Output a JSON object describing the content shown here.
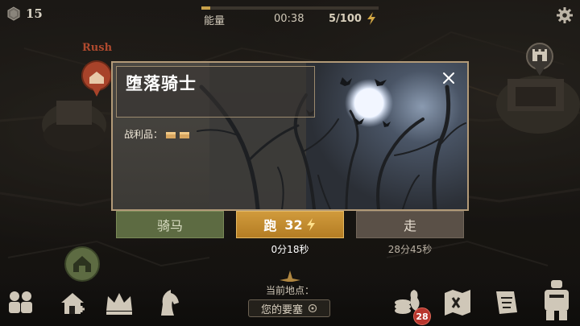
{
  "top_bar": {
    "gems": "15",
    "energy_label": "能量",
    "timer": "00:38",
    "energy_count": "5/100",
    "energy_fill": 0.05
  },
  "map": {
    "rush_label": "Rush"
  },
  "modal": {
    "title": "堕落骑士",
    "loot_label": "战利品："
  },
  "actions": {
    "horse_label": "骑马",
    "run_label": "跑",
    "run_cost": "32",
    "run_time": "0分18秒",
    "walk_label": "走",
    "walk_time": "28分45秒"
  },
  "bottom": {
    "location_caption": "当前地点：",
    "location_value": "您的要塞",
    "mail_badge": "28"
  },
  "colors": {
    "accent_gold": "#c9a14a",
    "horse_green": "#5d6b42",
    "run_orange": "#c08a30",
    "badge_red": "#b8362d"
  },
  "icons": [
    "gem-icon",
    "lightning-icon",
    "gear-icon",
    "close-icon",
    "chest-icon",
    "castle-icon",
    "home-icon",
    "heroes-icon",
    "build-icon",
    "crown-icon",
    "knight-icon",
    "resources-icon",
    "map-icon",
    "quests-icon",
    "inventory-icon",
    "location-target-icon"
  ]
}
